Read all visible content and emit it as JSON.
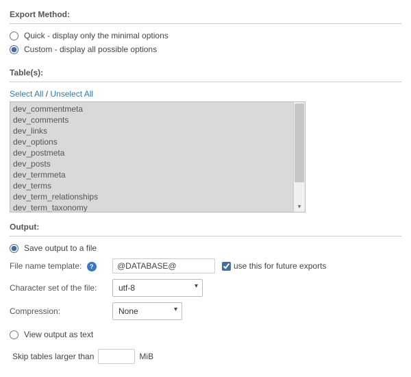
{
  "export_method": {
    "title": "Export Method:",
    "options": [
      {
        "label": "Quick - display only the minimal options",
        "selected": false
      },
      {
        "label": "Custom - display all possible options",
        "selected": true
      }
    ]
  },
  "tables": {
    "title": "Table(s):",
    "select_all": "Select All",
    "unselect_all": "Unselect All",
    "separator": " / ",
    "items": [
      "dev_commentmeta",
      "dev_comments",
      "dev_links",
      "dev_options",
      "dev_postmeta",
      "dev_posts",
      "dev_termmeta",
      "dev_terms",
      "dev_term_relationships",
      "dev_term_taxonomy"
    ]
  },
  "output": {
    "title": "Output:",
    "save_to_file": {
      "label": "Save output to a file",
      "selected": true
    },
    "filename_template": {
      "label": "File name template:",
      "value": "@DATABASE@",
      "future_label": "use this for future exports",
      "future_checked": true
    },
    "charset": {
      "label": "Character set of the file:",
      "value": "utf-8"
    },
    "compression": {
      "label": "Compression:",
      "value": "None"
    },
    "view_as_text": {
      "label": "View output as text",
      "selected": false
    },
    "skip_tables": {
      "prefix": "Skip tables larger than",
      "value": "",
      "suffix": "MiB"
    }
  }
}
